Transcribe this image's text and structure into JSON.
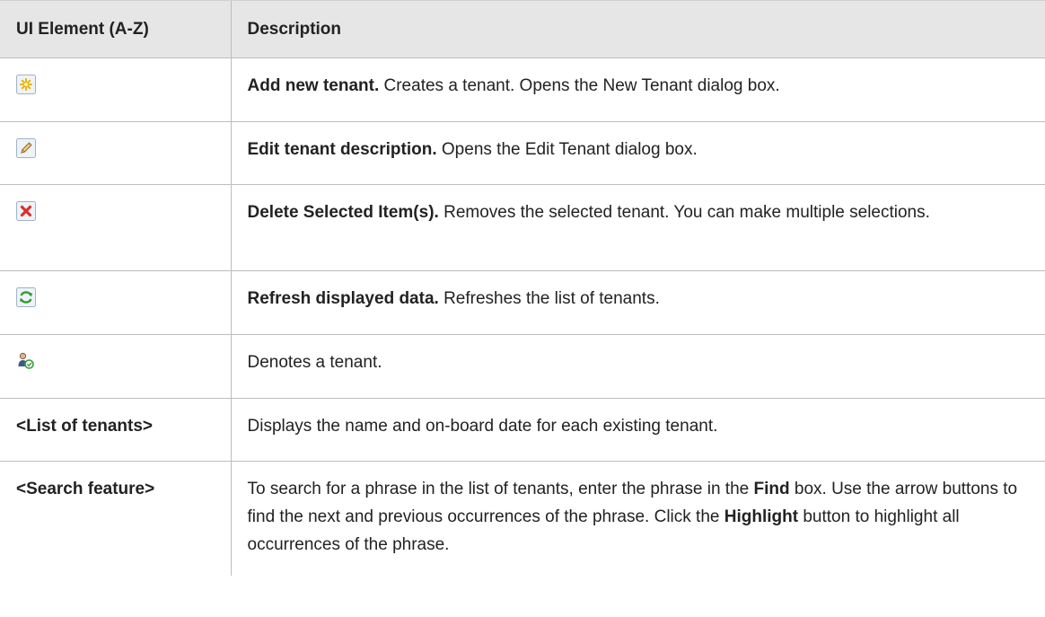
{
  "table": {
    "headers": [
      "UI Element (A-Z)",
      "Description"
    ],
    "rows": [
      {
        "icon": "add-tenant-icon",
        "bold": "Add new tenant.",
        "text": " Creates a tenant. Opens the New Tenant dialog box."
      },
      {
        "icon": "edit-pencil-icon",
        "bold": "Edit tenant description.",
        "text": " Opens the Edit Tenant dialog box."
      },
      {
        "icon": "delete-x-icon",
        "bold": "Delete Selected Item(s).",
        "text": " Removes the selected tenant. You can make multiple selections."
      },
      {
        "icon": "refresh-icon",
        "bold": "Refresh displayed data.",
        "text": " Refreshes the list of tenants."
      },
      {
        "icon": "tenant-icon",
        "text": "Denotes a tenant."
      },
      {
        "element": "<List of tenants>",
        "text": "Displays the name and on-board date for each existing tenant."
      },
      {
        "element": "<Search feature>",
        "parts": [
          "To search for a phrase in the list of tenants, enter the phrase in the ",
          "Find",
          " box. Use the arrow buttons to find the next and previous occurrences of the phrase. Click the ",
          "Highlight",
          " button to highlight all occurrences of the phrase."
        ]
      }
    ]
  },
  "colors": {
    "header_bg": "#e6e6e6",
    "border": "#bdbdbd",
    "text": "#222222"
  }
}
